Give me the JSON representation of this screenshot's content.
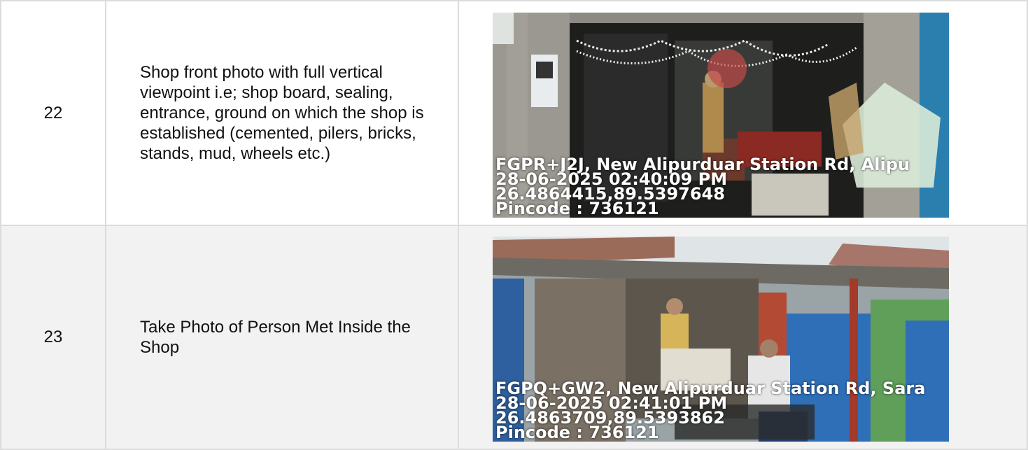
{
  "rows": [
    {
      "number": "22",
      "description": "Shop front photo with full vertical viewpoint i.e; shop board, sealing, entrance, ground on which the shop is established (cemented, pilers, bricks, stands, mud, wheels etc.)",
      "photo_stamp": {
        "address": "FGPR+J2J, New Alipurduar Station Rd, Alipu",
        "datetime": "28-06-2025 02:40:09 PM",
        "coords": "26.4864415,89.5397648",
        "pincode": "Pincode : 736121"
      }
    },
    {
      "number": "23",
      "description": "Take Photo of Person Met Inside the Shop",
      "photo_stamp": {
        "address": "FGPQ+GW2, New Alipurduar Station Rd, Sara",
        "datetime": "28-06-2025 02:41:01 PM",
        "coords": "26.4863709,89.5393862",
        "pincode": "Pincode : 736121"
      }
    }
  ]
}
